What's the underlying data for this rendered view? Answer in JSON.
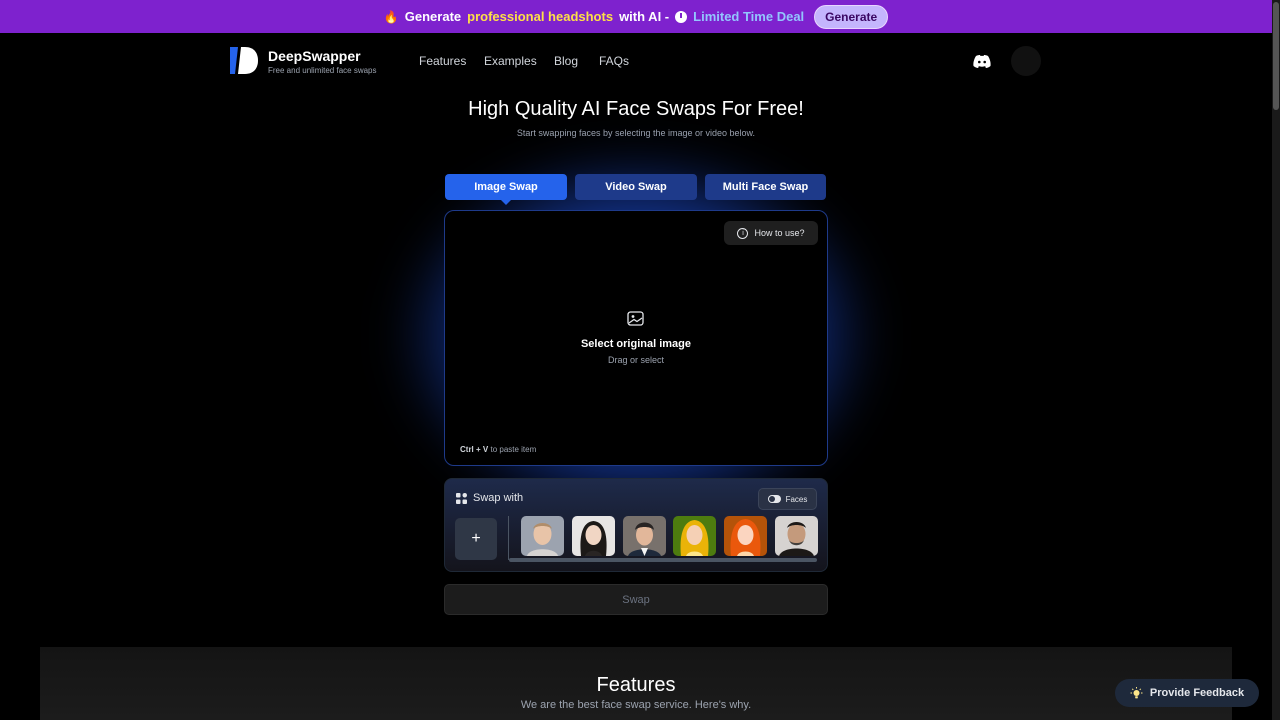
{
  "promo": {
    "fire_icon": "fire-icon",
    "prefix": "Generate",
    "highlight": "professional headshots",
    "suffix": "with AI -",
    "clock_icon": "clock-icon",
    "deal": "Limited Time Deal",
    "button": "Generate"
  },
  "header": {
    "brand_name": "DeepSwapper",
    "brand_tagline": "Free and unlimited face swaps",
    "nav": [
      "Features",
      "Examples",
      "Blog",
      "FAQs"
    ],
    "discord_icon": "discord-icon"
  },
  "hero": {
    "title": "High Quality AI Face Swaps For Free!",
    "subtitle": "Start swapping faces by selecting the image or video below."
  },
  "tabs": [
    {
      "label": "Image Swap",
      "active": true
    },
    {
      "label": "Video Swap",
      "active": false
    },
    {
      "label": "Multi Face Swap",
      "active": false
    }
  ],
  "dropzone": {
    "how_to": "How to use?",
    "title": "Select original image",
    "subtitle": "Drag or select",
    "paste_keys": "Ctrl + V",
    "paste_text": "to paste item"
  },
  "swap_with": {
    "label": "Swap with",
    "faces_toggle": "Faces",
    "add_label": "+",
    "faces": [
      "face-1",
      "face-2",
      "face-3",
      "face-4",
      "face-5",
      "face-6"
    ]
  },
  "swap_button": "Swap",
  "features": {
    "title": "Features",
    "subtitle": "We are the best face swap service. Here's why."
  },
  "feedback": "Provide Feedback",
  "colors": {
    "promo_bg": "#7e22ce",
    "accent": "#2563eb",
    "tab_inactive": "#1e3a8a",
    "glow": "#1d4ed8"
  }
}
